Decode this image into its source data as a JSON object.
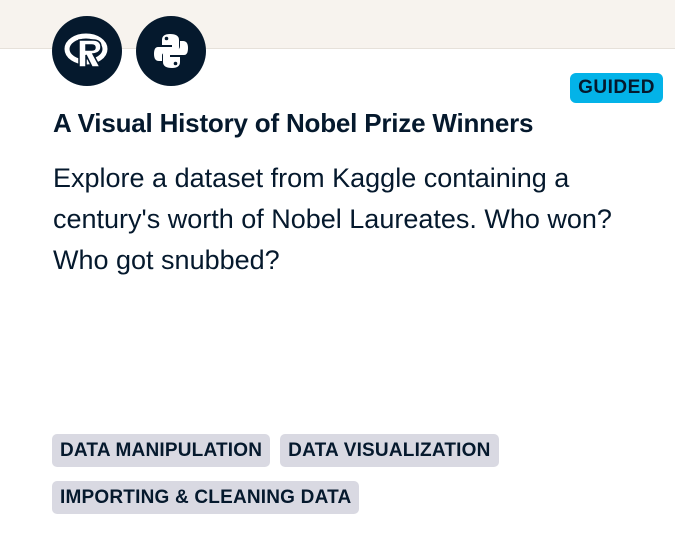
{
  "card": {
    "technologies": [
      {
        "name": "R",
        "icon": "r-logo-icon"
      },
      {
        "name": "Python",
        "icon": "python-logo-icon"
      }
    ],
    "badge": "GUIDED",
    "title": "A Visual History of Nobel Prize Winners",
    "description": "Explore a dataset from Kaggle containing a century's worth of Nobel Laureates. Who won? Who got snubbed?",
    "tags": [
      "DATA MANIPULATION",
      "DATA VISUALIZATION",
      "IMPORTING & CLEANING DATA"
    ]
  },
  "colors": {
    "navy": "#05192d",
    "badge_blue": "#03b3e8",
    "tag_gray": "#d9d9e2",
    "band": "#f7f3ee"
  }
}
